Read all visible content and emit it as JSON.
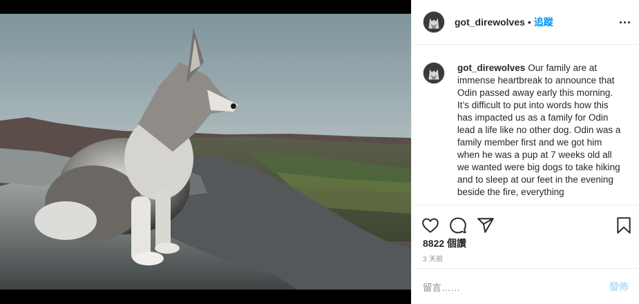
{
  "post": {
    "username": "got_direwolves",
    "separator": "•",
    "follow_label": "追蹤",
    "more_icon": "more-options-icon",
    "caption": "Our family are at immense heartbreak to announce that Odin passed away early this morning. It’s difficult to put into words how this has impacted us as a family for Odin lead a life like no other dog. Odin was a family member first and we got him when he was a pup at 7 weeks old all we wanted were big dogs to take hiking and to sleep at our feet in the evening beside the fire, everything",
    "likes": "8822 個讚",
    "time": "3 天前",
    "comment_placeholder": "留言……",
    "post_label": "發佈",
    "icons": {
      "like": "heart-icon",
      "comment": "comment-bubble-icon",
      "share": "paper-plane-icon",
      "save": "bookmark-icon"
    },
    "colors": {
      "link": "#0095f6",
      "post_disabled": "#b2dffc",
      "muted": "#8e8e8e",
      "border": "#efefef"
    }
  }
}
